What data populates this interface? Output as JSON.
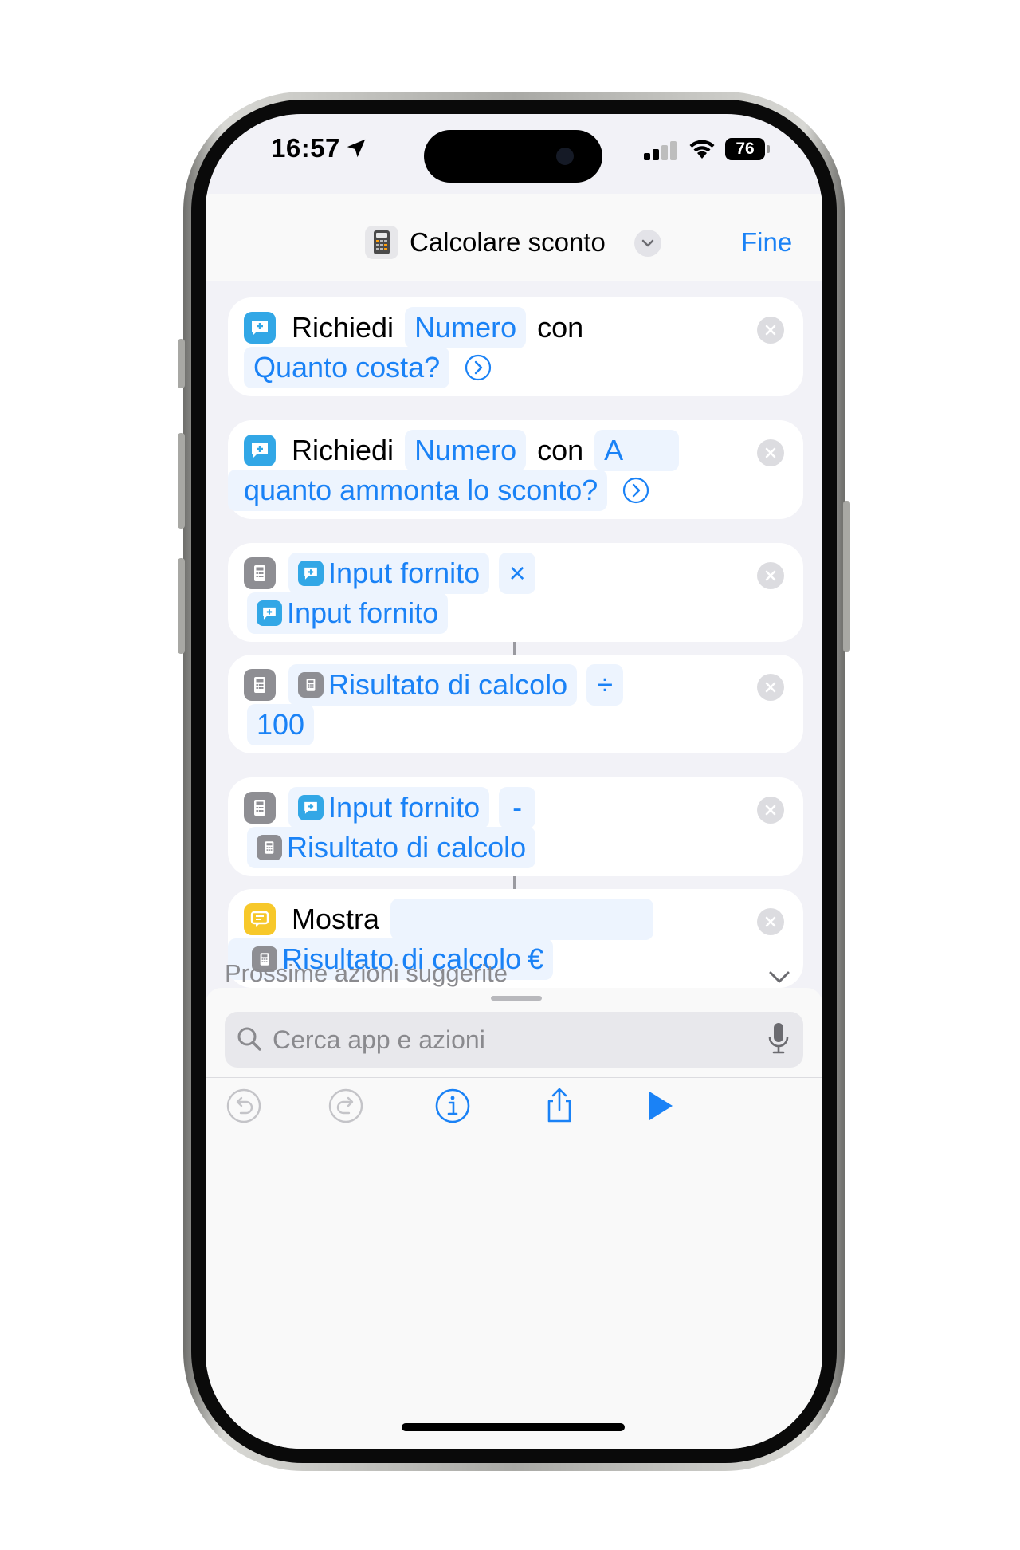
{
  "status_bar": {
    "time": "16:57",
    "battery": "76"
  },
  "nav": {
    "title": "Calcolare sconto",
    "done_label": "Fine"
  },
  "actions": [
    {
      "verb": "Richiedi",
      "type_token": "Numero",
      "connector": "con",
      "prompt": "Quanto costa?"
    },
    {
      "verb": "Richiedi",
      "type_token": "Numero",
      "connector": "con",
      "prompt_part1": "A",
      "prompt_part2": "quanto ammonta lo sconto?"
    },
    {
      "operand1": "Input fornito",
      "operator": "×",
      "operand2": "Input fornito"
    },
    {
      "operand1": "Risultato di calcolo",
      "operator": "÷",
      "operand2": "100"
    },
    {
      "operand1": "Input fornito",
      "operator": "-",
      "operand2": "Risultato di calcolo"
    },
    {
      "verb": "Mostra",
      "content": "Risultato di calcolo",
      "suffix": "€"
    }
  ],
  "suggestions": {
    "label": "Prossime azioni suggerite"
  },
  "search": {
    "placeholder": "Cerca app e azioni"
  },
  "colors": {
    "accent": "#1a82f6",
    "ask_icon": "#32a7e6",
    "calc_icon": "#8e8e93",
    "show_icon": "#f7c82a",
    "token_bg": "#edf4fe"
  }
}
